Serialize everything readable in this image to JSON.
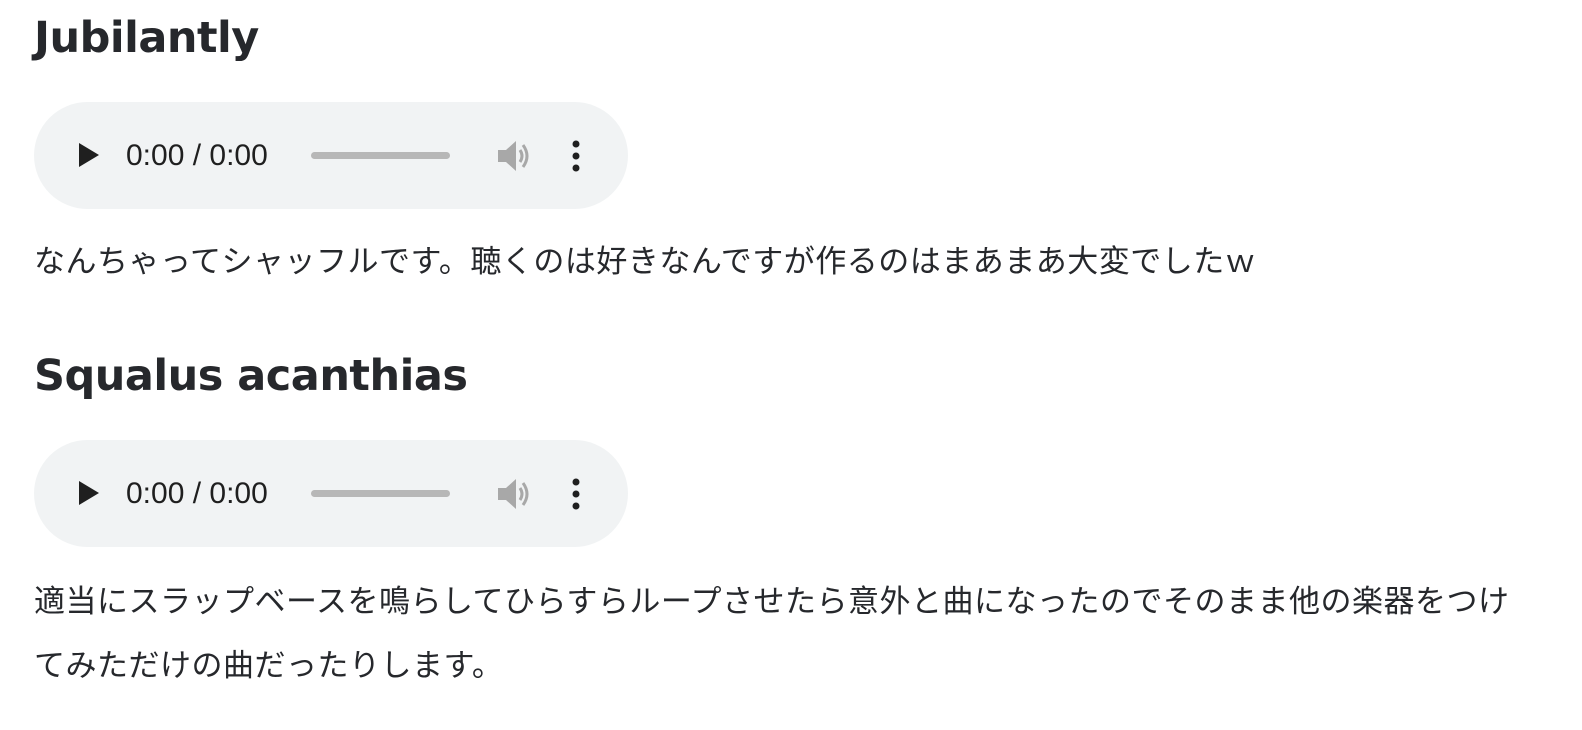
{
  "tracks": [
    {
      "title": "Jubilantly",
      "player": {
        "time": "0:00 / 0:00",
        "play_icon": "play-icon",
        "volume_icon": "volume-icon",
        "menu_icon": "more-vertical-icon",
        "progress": 0
      },
      "description": "なんちゃってシャッフルです。聴くのは好きなんですが作るのはまあまあ大変でしたｗ"
    },
    {
      "title": "Squalus acanthias",
      "player": {
        "time": "0:00 / 0:00",
        "play_icon": "play-icon",
        "volume_icon": "volume-icon",
        "menu_icon": "more-vertical-icon",
        "progress": 0
      },
      "description": "適当にスラップベースを鳴らしてひらすらループさせたら意外と曲になったのでそのまま他の楽器をつけてみただけの曲だったりします。"
    }
  ],
  "colors": {
    "player_bg": "#f1f3f4",
    "text": "#26282c",
    "seek_track": "#b7b7b7",
    "icon_dark": "#1f1f1f",
    "icon_disabled": "#a8a8a8"
  }
}
